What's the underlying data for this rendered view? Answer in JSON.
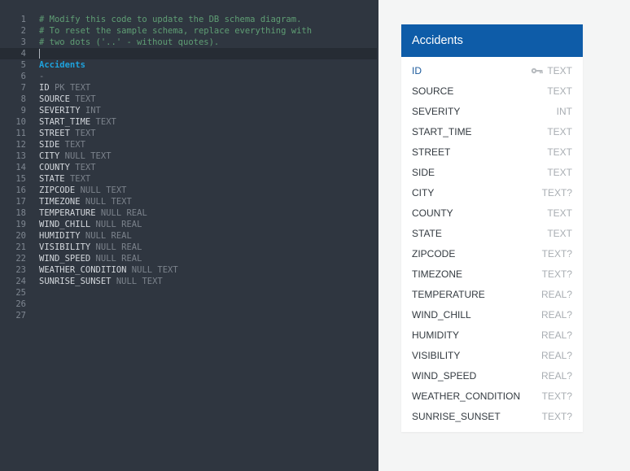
{
  "editor": {
    "lines": [
      {
        "n": "1",
        "kind": "comment",
        "text": "# Modify this code to update the DB schema diagram."
      },
      {
        "n": "2",
        "kind": "comment",
        "text": "# To reset the sample schema, replace everything with"
      },
      {
        "n": "3",
        "kind": "comment",
        "text": "# two dots ('..' - without quotes)."
      },
      {
        "n": "4",
        "kind": "empty",
        "text": ""
      },
      {
        "n": "5",
        "kind": "table",
        "text": "Accidents"
      },
      {
        "n": "6",
        "kind": "sep",
        "text": "-"
      },
      {
        "n": "7",
        "kind": "field",
        "name": "ID",
        "rest": "PK TEXT"
      },
      {
        "n": "8",
        "kind": "field",
        "name": "SOURCE",
        "rest": "TEXT"
      },
      {
        "n": "9",
        "kind": "field",
        "name": "SEVERITY",
        "rest": "INT"
      },
      {
        "n": "10",
        "kind": "field",
        "name": "START_TIME",
        "rest": "TEXT"
      },
      {
        "n": "11",
        "kind": "field",
        "name": "STREET",
        "rest": "TEXT"
      },
      {
        "n": "12",
        "kind": "field",
        "name": "SIDE",
        "rest": "TEXT"
      },
      {
        "n": "13",
        "kind": "field",
        "name": "CITY",
        "rest": "NULL TEXT"
      },
      {
        "n": "14",
        "kind": "field",
        "name": "COUNTY",
        "rest": "TEXT"
      },
      {
        "n": "15",
        "kind": "field",
        "name": "STATE",
        "rest": "TEXT"
      },
      {
        "n": "16",
        "kind": "field",
        "name": "ZIPCODE",
        "rest": "NULL TEXT"
      },
      {
        "n": "17",
        "kind": "field",
        "name": "TIMEZONE",
        "rest": "NULL TEXT"
      },
      {
        "n": "18",
        "kind": "field",
        "name": "TEMPERATURE",
        "rest": "NULL REAL"
      },
      {
        "n": "19",
        "kind": "field",
        "name": "WIND_CHILL",
        "rest": "NULL REAL"
      },
      {
        "n": "20",
        "kind": "field",
        "name": "HUMIDITY",
        "rest": "NULL REAL"
      },
      {
        "n": "21",
        "kind": "field",
        "name": "VISIBILITY",
        "rest": "NULL REAL"
      },
      {
        "n": "22",
        "kind": "field",
        "name": "WIND_SPEED",
        "rest": "NULL REAL"
      },
      {
        "n": "23",
        "kind": "field",
        "name": "WEATHER_CONDITION",
        "rest": "NULL TEXT"
      },
      {
        "n": "24",
        "kind": "field",
        "name": "SUNRISE_SUNSET",
        "rest": "NULL TEXT"
      },
      {
        "n": "25",
        "kind": "empty",
        "text": ""
      },
      {
        "n": "26",
        "kind": "empty",
        "text": ""
      },
      {
        "n": "27",
        "kind": "empty",
        "text": ""
      }
    ]
  },
  "diagram": {
    "table_name": "Accidents",
    "header_color": "#0e5ca8",
    "fields": [
      {
        "name": "ID",
        "type": "TEXT",
        "pk": true,
        "icon": "key-icon"
      },
      {
        "name": "SOURCE",
        "type": "TEXT"
      },
      {
        "name": "SEVERITY",
        "type": "INT"
      },
      {
        "name": "START_TIME",
        "type": "TEXT"
      },
      {
        "name": "STREET",
        "type": "TEXT"
      },
      {
        "name": "SIDE",
        "type": "TEXT"
      },
      {
        "name": "CITY",
        "type": "TEXT?"
      },
      {
        "name": "COUNTY",
        "type": "TEXT"
      },
      {
        "name": "STATE",
        "type": "TEXT"
      },
      {
        "name": "ZIPCODE",
        "type": "TEXT?"
      },
      {
        "name": "TIMEZONE",
        "type": "TEXT?"
      },
      {
        "name": "TEMPERATURE",
        "type": "REAL?"
      },
      {
        "name": "WIND_CHILL",
        "type": "REAL?"
      },
      {
        "name": "HUMIDITY",
        "type": "REAL?"
      },
      {
        "name": "VISIBILITY",
        "type": "REAL?"
      },
      {
        "name": "WIND_SPEED",
        "type": "REAL?"
      },
      {
        "name": "WEATHER_CONDITION",
        "type": "TEXT?"
      },
      {
        "name": "SUNRISE_SUNSET",
        "type": "TEXT?"
      }
    ]
  }
}
